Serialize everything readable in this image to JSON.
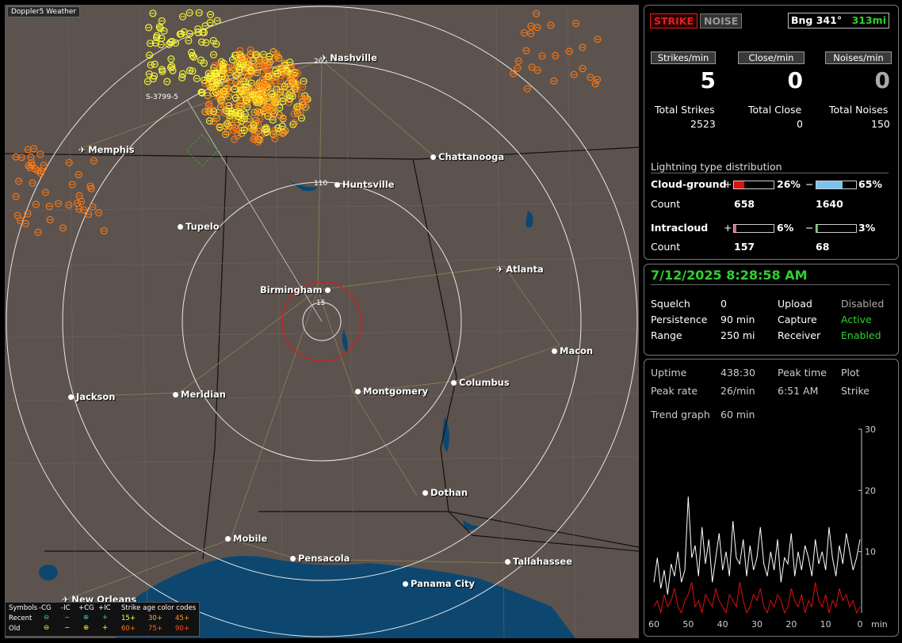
{
  "app_title": "Doppler5 Weather",
  "map": {
    "cities": [
      {
        "name": "Nashville",
        "type": "plane"
      },
      {
        "name": "Memphis",
        "type": "plane"
      },
      {
        "name": "Chattanooga",
        "type": "dot"
      },
      {
        "name": "Huntsville",
        "type": "dot"
      },
      {
        "name": "Tupelo",
        "type": "dot"
      },
      {
        "name": "Atlanta",
        "type": "plane"
      },
      {
        "name": "Birmingham",
        "type": "dot"
      },
      {
        "name": "Macon",
        "type": "dot"
      },
      {
        "name": "Jackson",
        "type": "dot"
      },
      {
        "name": "Meridian",
        "type": "dot"
      },
      {
        "name": "Montgomery",
        "type": "dot"
      },
      {
        "name": "Columbus",
        "type": "dot"
      },
      {
        "name": "Dothan",
        "type": "dot"
      },
      {
        "name": "Mobile",
        "type": "dot"
      },
      {
        "name": "Pensacola",
        "type": "dot"
      },
      {
        "name": "Tallahassee",
        "type": "dot"
      },
      {
        "name": "Panama City",
        "type": "dot"
      },
      {
        "name": "New Orleans",
        "type": "plane"
      }
    ],
    "ring_labels": [
      "205",
      "110",
      "15"
    ],
    "bearing_label": "S-3799-5",
    "colors": {
      "land": "#5c534e",
      "water": "#0d4770",
      "ring": "#e8e8e8",
      "close_ring": "#d21e1e",
      "recent": "#ffff33",
      "mid": "#ffb21e",
      "old": "#ff7814"
    }
  },
  "legend": {
    "symbols_label": "Symbols",
    "cols": [
      "-CG",
      "-IC",
      "+CG",
      "+IC"
    ],
    "age_label": "Strike age color codes",
    "recent_label": "Recent",
    "old_label": "Old",
    "recent_ages": [
      "15+",
      "30+",
      "45+"
    ],
    "old_ages": [
      "60+",
      "75+",
      "90+"
    ]
  },
  "status": {
    "strike_tag": "STRIKE",
    "noise_tag": "NOISE",
    "bearing": "Bng 341°",
    "distance": "313mi",
    "rates": [
      {
        "label": "Strikes/min",
        "value": "5",
        "total_label": "Total Strikes",
        "total": "2523"
      },
      {
        "label": "Close/min",
        "value": "0",
        "total_label": "Total Close",
        "total": "0"
      },
      {
        "label": "Noises/min",
        "value": "0",
        "total_label": "Total Noises",
        "total": "150"
      }
    ],
    "dist_title": "Lightning type distribution",
    "cloud_ground": {
      "label": "Cloud-ground",
      "pos_pct": "26%",
      "neg_pct": "65%",
      "pos_frac": 0.26,
      "neg_frac": 0.65,
      "count_label": "Count",
      "pos_count": "658",
      "neg_count": "1640"
    },
    "intracloud": {
      "label": "Intracloud",
      "pos_pct": "6%",
      "neg_pct": "3%",
      "pos_frac": 0.06,
      "neg_frac": 0.03,
      "count_label": "Count",
      "pos_count": "157",
      "neg_count": "68"
    }
  },
  "info": {
    "datetime": "7/12/2025 8:28:58 AM",
    "rows": [
      [
        "Squelch",
        "0",
        "Upload",
        "Disabled"
      ],
      [
        "Persistence",
        "90 min",
        "Capture",
        "Active"
      ],
      [
        "Range",
        "250 mi",
        "Receiver",
        "Enabled"
      ]
    ]
  },
  "trend": {
    "uptime_label": "Uptime",
    "uptime": "438:30",
    "peak_time_label": "Peak time",
    "plot_label": "Plot",
    "peak_rate_label": "Peak rate",
    "peak_rate": "26/min",
    "peak_time": "6:51 AM",
    "plot": "Strike",
    "graph_label": "Trend graph",
    "graph_span": "60 min",
    "y_ticks": [
      "30",
      "20",
      "10"
    ],
    "x_ticks": [
      "60",
      "50",
      "40",
      "30",
      "20",
      "10",
      "0"
    ],
    "x_unit": "min"
  },
  "chart_data": {
    "type": "line",
    "xlabel": "min",
    "xlim": [
      60,
      0
    ],
    "ylim": [
      0,
      30
    ],
    "series": [
      {
        "name": "",
        "values": [
          5,
          9,
          4,
          7,
          3,
          8,
          6,
          10,
          5,
          7,
          19,
          9,
          11,
          6,
          14,
          8,
          12,
          5,
          9,
          13,
          7,
          10,
          6,
          15,
          9,
          8,
          12,
          6,
          11,
          7,
          9,
          14,
          8,
          6,
          10,
          7,
          12,
          5,
          9,
          8,
          13,
          6,
          10,
          7,
          11,
          9,
          6,
          12,
          8,
          10,
          7,
          14,
          9,
          6,
          11,
          8,
          13,
          10,
          7,
          9,
          12
        ]
      },
      {
        "name": "",
        "values": [
          1,
          2,
          0,
          3,
          1,
          2,
          4,
          1,
          0,
          2,
          3,
          5,
          1,
          2,
          0,
          3,
          2,
          1,
          4,
          2,
          1,
          0,
          3,
          2,
          1,
          5,
          2,
          0,
          1,
          3,
          2,
          4,
          1,
          0,
          2,
          1,
          3,
          2,
          0,
          1,
          4,
          2,
          1,
          3,
          0,
          2,
          1,
          5,
          2,
          1,
          3,
          0,
          2,
          1,
          4,
          2,
          3,
          1,
          2,
          0,
          1
        ]
      }
    ]
  }
}
